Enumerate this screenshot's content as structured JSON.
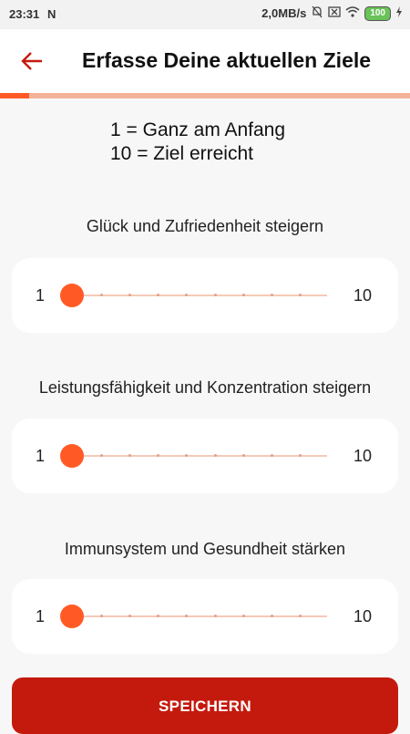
{
  "status_bar": {
    "time": "23:31",
    "network_speed": "2,0MB/s",
    "battery": "100",
    "app_icon": "N"
  },
  "header": {
    "title": "Erfasse Deine aktuellen Ziele",
    "back_icon": "arrow-left-icon",
    "accent_color": "#c41a0e"
  },
  "progress": {
    "value": 0.07
  },
  "legend": {
    "line1": "1 = Ganz am Anfang",
    "line2": "10 = Ziel erreicht"
  },
  "goals": [
    {
      "title": "Glück und Zufriedenheit steigern",
      "min": "1",
      "max": "10",
      "value": 1
    },
    {
      "title": "Leistungsfähigkeit und Konzentration steigern",
      "min": "1",
      "max": "10",
      "value": 1
    },
    {
      "title": "Immunsystem und Gesundheit stärken",
      "min": "1",
      "max": "10",
      "value": 1
    }
  ],
  "save_button": {
    "label": "SPEICHERN",
    "color": "#c41a0e"
  },
  "slider_color": "#ff5a26"
}
